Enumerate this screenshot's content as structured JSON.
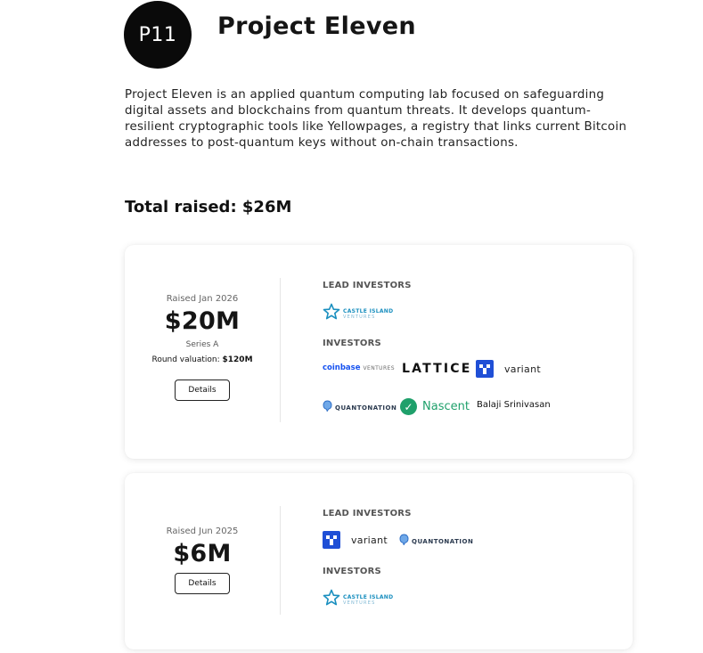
{
  "company": {
    "logo_text": "P11",
    "name": "Project Eleven",
    "description": "Project Eleven is an applied quantum computing lab focused on safeguarding digital assets and blockchains from quantum threats. It develops quantum-resilient cryptographic tools like Yellowpages, a registry that links current Bitcoin addresses to post-quantum keys without on-chain transactions."
  },
  "total_raised": "Total raised: $26M",
  "labels": {
    "lead_investors": "LEAD INVESTORS",
    "investors": "INVESTORS",
    "details": "Details",
    "round_valuation": "Round valuation:"
  },
  "logos": {
    "castle_island_main": "CASTLE ISLAND",
    "castle_island_sub": "VENTURES",
    "coinbase_main": "coinbase",
    "coinbase_sub": "VENTURES",
    "lattice": "LATTICE",
    "variant": "variant",
    "quantonation": "QUANTONATION",
    "nascent": "Nascent",
    "balaji": "Balaji Srinivasan"
  },
  "rounds": [
    {
      "raised_date": "Raised Jan 2026",
      "amount": "$20M",
      "series": "Series A",
      "valuation": "$120M",
      "lead_investors": [
        "Castle Island Ventures"
      ],
      "investors": [
        "Coinbase Ventures",
        "Lattice",
        "Variant",
        "Quantonation",
        "Nascent",
        "Balaji Srinivasan"
      ]
    },
    {
      "raised_date": "Raised Jun 2025",
      "amount": "$6M",
      "lead_investors": [
        "Variant",
        "Quantonation"
      ],
      "investors": [
        "Castle Island Ventures"
      ]
    }
  ],
  "colors": {
    "castle_island": "#1a8fbf",
    "coinbase": "#1652f0",
    "variant": "#1f4fd6",
    "nascent": "#1fa06b",
    "quantonation": "#2b3a4f"
  },
  "icons": {
    "castle_island": "star-outline-icon",
    "variant": "variant-logo-icon",
    "quantonation": "quantonation-q-icon",
    "nascent": "check-circle-icon"
  }
}
